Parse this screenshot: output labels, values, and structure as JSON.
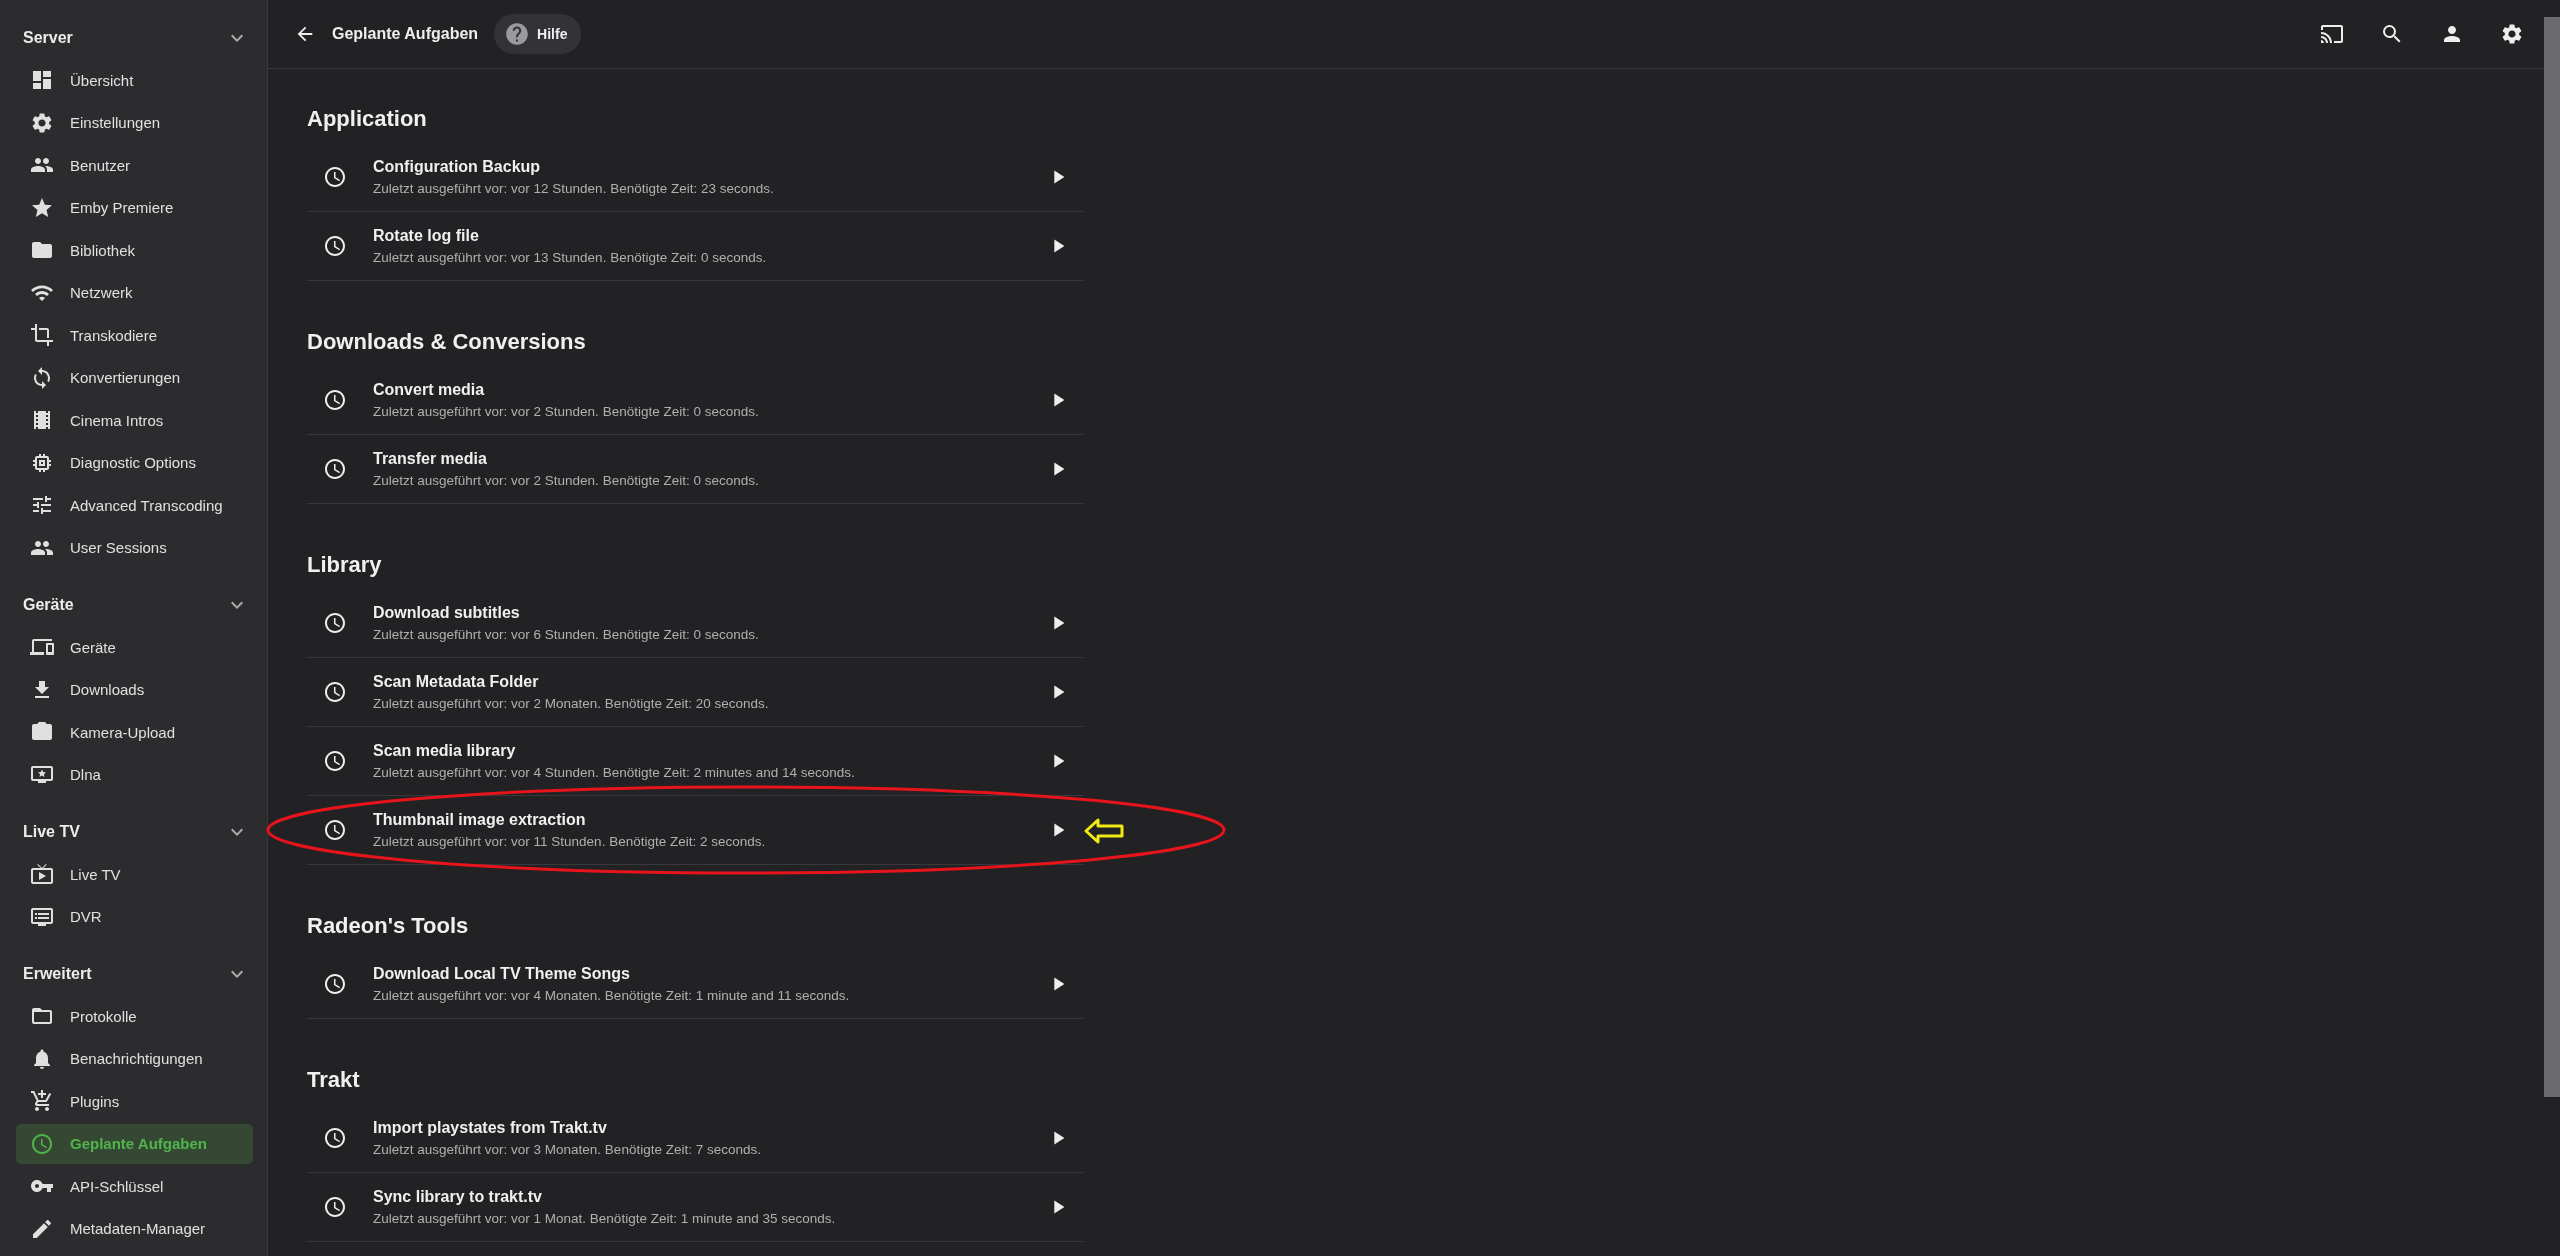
{
  "sidebar": {
    "sections": [
      {
        "title": "Server",
        "expanded": true,
        "items": [
          {
            "label": "Übersicht",
            "selected": false
          },
          {
            "label": "Einstellungen",
            "selected": false
          },
          {
            "label": "Benutzer",
            "selected": false
          },
          {
            "label": "Emby Premiere",
            "selected": false
          },
          {
            "label": "Bibliothek",
            "selected": false
          },
          {
            "label": "Netzwerk",
            "selected": false
          },
          {
            "label": "Transkodiere",
            "selected": false
          },
          {
            "label": "Konvertierungen",
            "selected": false
          },
          {
            "label": "Cinema Intros",
            "selected": false
          },
          {
            "label": "Diagnostic Options",
            "selected": false
          },
          {
            "label": "Advanced Transcoding",
            "selected": false
          },
          {
            "label": "User Sessions",
            "selected": false
          }
        ]
      },
      {
        "title": "Geräte",
        "expanded": true,
        "items": [
          {
            "label": "Geräte",
            "selected": false
          },
          {
            "label": "Downloads",
            "selected": false
          },
          {
            "label": "Kamera-Upload",
            "selected": false
          },
          {
            "label": "Dlna",
            "selected": false
          }
        ]
      },
      {
        "title": "Live TV",
        "expanded": true,
        "items": [
          {
            "label": "Live TV",
            "selected": false
          },
          {
            "label": "DVR",
            "selected": false
          }
        ]
      },
      {
        "title": "Erweitert",
        "expanded": true,
        "items": [
          {
            "label": "Protokolle",
            "selected": false
          },
          {
            "label": "Benachrichtigungen",
            "selected": false
          },
          {
            "label": "Plugins",
            "selected": false
          },
          {
            "label": "Geplante Aufgaben",
            "selected": true
          },
          {
            "label": "API-Schlüssel",
            "selected": false
          },
          {
            "label": "Metadaten-Manager",
            "selected": false
          }
        ]
      }
    ]
  },
  "header": {
    "title": "Geplante Aufgaben",
    "help_button": "Hilfe"
  },
  "task_groups": [
    {
      "title": "Application",
      "tasks": [
        {
          "name": "Configuration Backup",
          "status": "Zuletzt ausgeführt vor: vor 12 Stunden. Benötigte Zeit: 23 seconds.",
          "annotated": false
        },
        {
          "name": "Rotate log file",
          "status": "Zuletzt ausgeführt vor: vor 13 Stunden. Benötigte Zeit: 0 seconds.",
          "annotated": false
        }
      ]
    },
    {
      "title": "Downloads & Conversions",
      "tasks": [
        {
          "name": "Convert media",
          "status": "Zuletzt ausgeführt vor: vor 2 Stunden. Benötigte Zeit: 0 seconds.",
          "annotated": false
        },
        {
          "name": "Transfer media",
          "status": "Zuletzt ausgeführt vor: vor 2 Stunden. Benötigte Zeit: 0 seconds.",
          "annotated": false
        }
      ]
    },
    {
      "title": "Library",
      "tasks": [
        {
          "name": "Download subtitles",
          "status": "Zuletzt ausgeführt vor: vor 6 Stunden. Benötigte Zeit: 0 seconds.",
          "annotated": false
        },
        {
          "name": "Scan Metadata Folder",
          "status": "Zuletzt ausgeführt vor: vor 2 Monaten. Benötigte Zeit: 20 seconds.",
          "annotated": false
        },
        {
          "name": "Scan media library",
          "status": "Zuletzt ausgeführt vor: vor 4 Stunden. Benötigte Zeit: 2 minutes and 14 seconds.",
          "annotated": false
        },
        {
          "name": "Thumbnail image extraction",
          "status": "Zuletzt ausgeführt vor: vor 11 Stunden. Benötigte Zeit: 2 seconds.",
          "annotated": true
        }
      ]
    },
    {
      "title": "Radeon's Tools",
      "tasks": [
        {
          "name": "Download Local TV Theme Songs",
          "status": "Zuletzt ausgeführt vor: vor 4 Monaten. Benötigte Zeit: 1 minute and 11 seconds.",
          "annotated": false
        }
      ]
    },
    {
      "title": "Trakt",
      "tasks": [
        {
          "name": "Import playstates from Trakt.tv",
          "status": "Zuletzt ausgeführt vor: vor 3 Monaten. Benötigte Zeit: 7 seconds.",
          "annotated": false
        },
        {
          "name": "Sync library to trakt.tv",
          "status": "Zuletzt ausgeführt vor: vor 1 Monat. Benötigte Zeit: 1 minute and 35 seconds.",
          "annotated": false
        }
      ]
    }
  ]
}
